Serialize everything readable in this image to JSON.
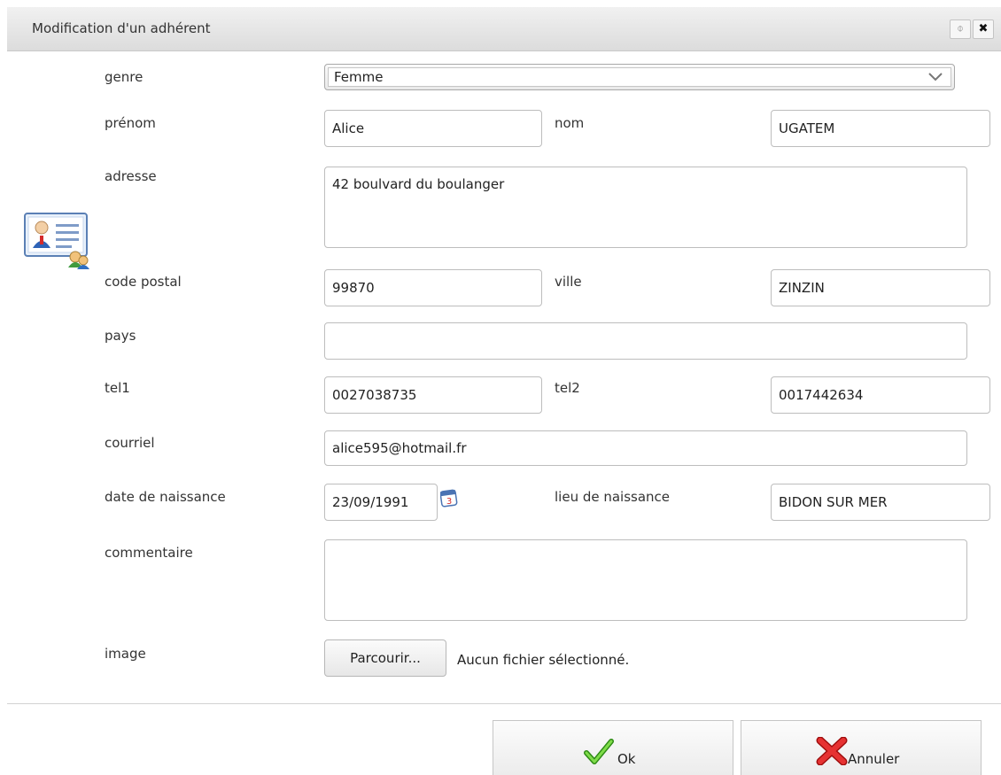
{
  "dialog": {
    "title": "Modification d'un adhérent",
    "restore_icon": "⌽",
    "close_icon": "✖"
  },
  "form": {
    "genre": {
      "label": "genre",
      "value": "Femme"
    },
    "prenom": {
      "label": "prénom",
      "value": "Alice"
    },
    "nom": {
      "label": "nom",
      "value": "UGATEM"
    },
    "adresse": {
      "label": "adresse",
      "value": "42 boulvard du boulanger"
    },
    "code_postal": {
      "label": "code postal",
      "value": "99870"
    },
    "ville": {
      "label": "ville",
      "value": "ZINZIN"
    },
    "pays": {
      "label": "pays",
      "value": ""
    },
    "tel1": {
      "label": "tel1",
      "value": "0027038735"
    },
    "tel2": {
      "label": "tel2",
      "value": "0017442634"
    },
    "courriel": {
      "label": "courriel",
      "value": "alice595@hotmail.fr"
    },
    "date_naissance": {
      "label": "date de naissance",
      "value": "23/09/1991"
    },
    "lieu_naissance": {
      "label": "lieu de naissance",
      "value": "BIDON SUR MER"
    },
    "commentaire": {
      "label": "commentaire",
      "value": ""
    },
    "image": {
      "label": "image",
      "browse_label": "Parcourir...",
      "no_file_text": "Aucun fichier sélectionné."
    }
  },
  "buttons": {
    "ok_label": "Ok",
    "cancel_label": "Annuler"
  },
  "icons": {
    "member_card": "member-card-icon",
    "calendar": "calendar-icon",
    "calendar_day": "3",
    "ok": "checkmark-icon",
    "cancel": "red-x-icon"
  },
  "colors": {
    "ok_green": "#49b81a",
    "cancel_red": "#d61616"
  }
}
